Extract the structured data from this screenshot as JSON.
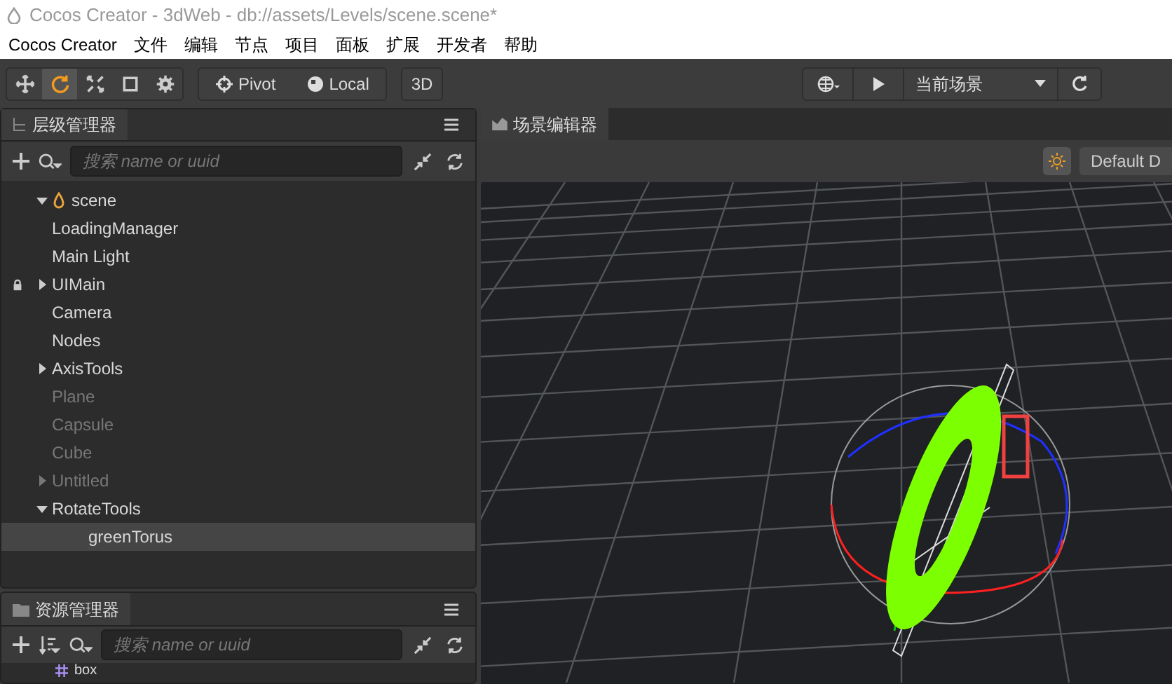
{
  "window": {
    "title": "Cocos Creator - 3dWeb - db://assets/Levels/scene.scene*"
  },
  "menu": [
    "Cocos Creator",
    "文件",
    "编辑",
    "节点",
    "项目",
    "面板",
    "扩展",
    "开发者",
    "帮助"
  ],
  "toolbar": {
    "tools": [
      {
        "kind": "move",
        "selected": false
      },
      {
        "kind": "rotate",
        "selected": true
      },
      {
        "kind": "scale",
        "selected": false
      },
      {
        "kind": "rect",
        "selected": false
      },
      {
        "kind": "gear",
        "selected": false
      }
    ],
    "pivot": "Pivot",
    "local": "Local",
    "mode": "3D",
    "scene_select": "当前场景"
  },
  "hierarchy": {
    "title": "层级管理器",
    "search_placeholder": "搜索 name or uuid",
    "tree": [
      {
        "label": "scene",
        "kind": "scene",
        "expanded": true,
        "locked": false,
        "dimmed": false,
        "selected": false,
        "children": [
          {
            "label": "LoadingManager",
            "locked": false,
            "dimmed": false,
            "selected": false
          },
          {
            "label": "Main Light",
            "locked": false,
            "dimmed": false,
            "selected": false
          },
          {
            "label": "UIMain",
            "expanded": false,
            "locked": true,
            "dimmed": false,
            "selected": false
          },
          {
            "label": "Camera",
            "locked": false,
            "dimmed": false,
            "selected": false
          },
          {
            "label": "Nodes",
            "locked": false,
            "dimmed": false,
            "selected": false
          },
          {
            "label": "AxisTools",
            "expanded": false,
            "locked": false,
            "dimmed": false,
            "selected": false
          },
          {
            "label": "Plane",
            "locked": false,
            "dimmed": true,
            "selected": false
          },
          {
            "label": "Capsule",
            "locked": false,
            "dimmed": true,
            "selected": false
          },
          {
            "label": "Cube",
            "locked": false,
            "dimmed": true,
            "selected": false
          },
          {
            "label": "Untitled",
            "expanded": false,
            "locked": false,
            "dimmed": true,
            "selected": false
          },
          {
            "label": "RotateTools",
            "expanded": true,
            "locked": false,
            "dimmed": false,
            "selected": false,
            "children": [
              {
                "label": "greenTorus",
                "locked": false,
                "dimmed": false,
                "selected": true
              }
            ]
          }
        ]
      }
    ]
  },
  "assets": {
    "title": "资源管理器",
    "search_placeholder": "搜索 name or uuid",
    "items": [
      {
        "label": "box"
      }
    ]
  },
  "scene_editor": {
    "title": "场景编辑器",
    "camera_button": "Default D"
  }
}
